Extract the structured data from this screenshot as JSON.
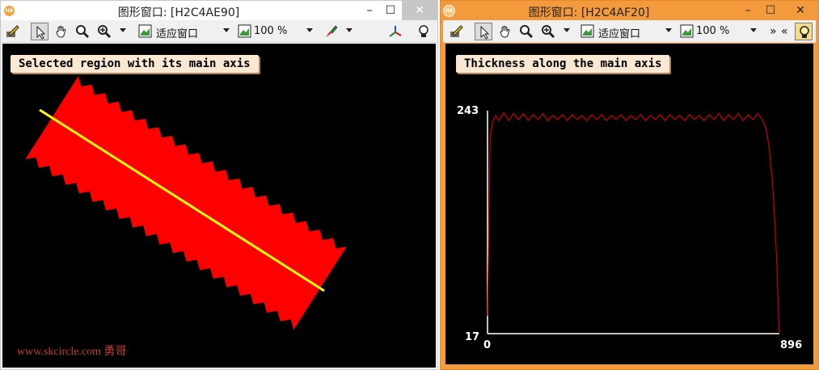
{
  "window_left": {
    "title": "图形窗口: [H2C4AE90]",
    "logo_text": "HA",
    "controls": {
      "minimize": "–",
      "maximize": "☐",
      "close": "✕"
    },
    "toolbar": {
      "fit_label": "适应窗口",
      "zoom_label": "100 %"
    },
    "caption": "Selected region with its main axis",
    "watermark": "www.skcircle.com 勇哥",
    "colors": {
      "region": "#ff0000",
      "axis_line": "#ffff00"
    }
  },
  "window_right": {
    "title": "图形窗口: [H2C4AF20]",
    "logo_text": "HA",
    "controls": {
      "minimize": "–",
      "maximize": "☐",
      "close": "✕"
    },
    "toolbar": {
      "fit_label": "适应窗口",
      "zoom_label": "100 %",
      "more_right": "»",
      "more_left": "«"
    },
    "caption": "Thickness along the main axis"
  },
  "chart_data": {
    "type": "line",
    "title": "Thickness along the main axis",
    "xlabel": "",
    "ylabel": "",
    "xlim": [
      0,
      896
    ],
    "ylim": [
      17,
      243
    ],
    "x_tick_labels": [
      "0",
      "896"
    ],
    "y_tick_labels": [
      "17",
      "243"
    ],
    "series": [
      {
        "color": "#cc0000",
        "x": [
          0,
          8,
          16,
          25,
          35,
          50,
          65,
          80,
          95,
          110,
          125,
          140,
          155,
          170,
          185,
          200,
          215,
          230,
          245,
          260,
          275,
          290,
          305,
          320,
          335,
          350,
          365,
          380,
          395,
          410,
          425,
          440,
          455,
          470,
          485,
          500,
          515,
          530,
          545,
          560,
          575,
          590,
          605,
          620,
          635,
          650,
          665,
          680,
          695,
          710,
          725,
          740,
          755,
          770,
          785,
          800,
          815,
          830,
          845,
          855,
          865,
          875,
          882,
          888,
          892,
          896
        ],
        "y": [
          35,
          215,
          232,
          238,
          233,
          241,
          233,
          240,
          234,
          240,
          233,
          239,
          234,
          240,
          233,
          238,
          234,
          239,
          233,
          239,
          234,
          238,
          233,
          239,
          234,
          239,
          233,
          238,
          234,
          239,
          233,
          238,
          234,
          239,
          233,
          238,
          234,
          239,
          233,
          239,
          234,
          238,
          233,
          239,
          234,
          238,
          233,
          239,
          234,
          240,
          233,
          239,
          234,
          240,
          233,
          239,
          234,
          240,
          233,
          225,
          205,
          170,
          130,
          90,
          50,
          17
        ]
      }
    ],
    "grid": false,
    "legend": "none"
  }
}
